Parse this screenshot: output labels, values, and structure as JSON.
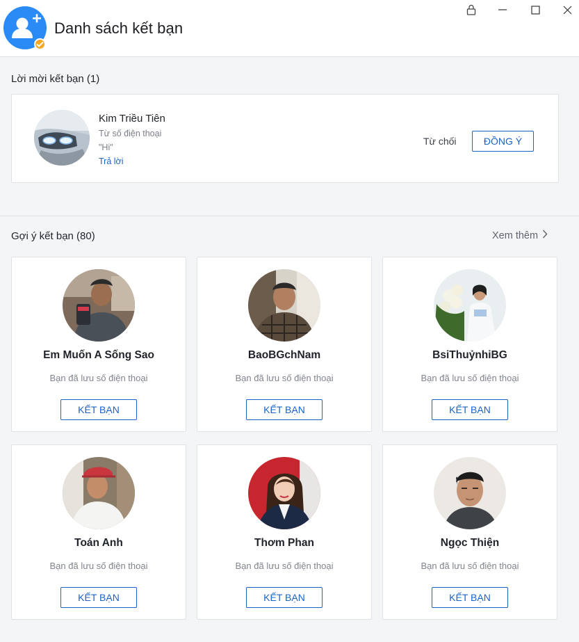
{
  "window": {
    "title": "Danh sách kết bạn",
    "app_icon": "add-user-icon",
    "controls": [
      "lock-icon",
      "minimize-icon",
      "maximize-icon",
      "close-icon"
    ]
  },
  "requests": {
    "header": "Lời mời kết bạn (1)",
    "items": [
      {
        "name": "Kim Triều Tiên",
        "source": "Từ số điện thoại",
        "message": "\"Hi\"",
        "reply_label": "Trả lời",
        "reject_label": "Từ chối",
        "accept_label": "ĐỒNG Ý"
      }
    ]
  },
  "suggestions": {
    "header": "Gợi ý kết bạn (80)",
    "see_more_label": "Xem thêm",
    "items": [
      {
        "name": "Em Muốn A Sống Sao",
        "subtitle": "Bạn đã lưu số điện thoại",
        "button_label": "KẾT BẠN"
      },
      {
        "name": "BaoBGchNam",
        "subtitle": "Bạn đã lưu số điện thoại",
        "button_label": "KẾT BẠN"
      },
      {
        "name": "BsiThuỷnhiBG",
        "subtitle": "Bạn đã lưu số điện thoại",
        "button_label": "KẾT BẠN"
      },
      {
        "name": "Toán Anh",
        "subtitle": "Bạn đã lưu số điện thoại",
        "button_label": "KẾT BẠN"
      },
      {
        "name": "Thơm Phan",
        "subtitle": "Bạn đã lưu số điện thoại",
        "button_label": "KẾT BẠN"
      },
      {
        "name": "Ngọc Thiện",
        "subtitle": "Bạn đã lưu số điện thoại",
        "button_label": "KẾT BẠN"
      }
    ]
  },
  "colors": {
    "accent": "#1a63c8",
    "app_icon": "#2a8af6",
    "badge": "#f5a623",
    "background": "#f4f5f7"
  }
}
